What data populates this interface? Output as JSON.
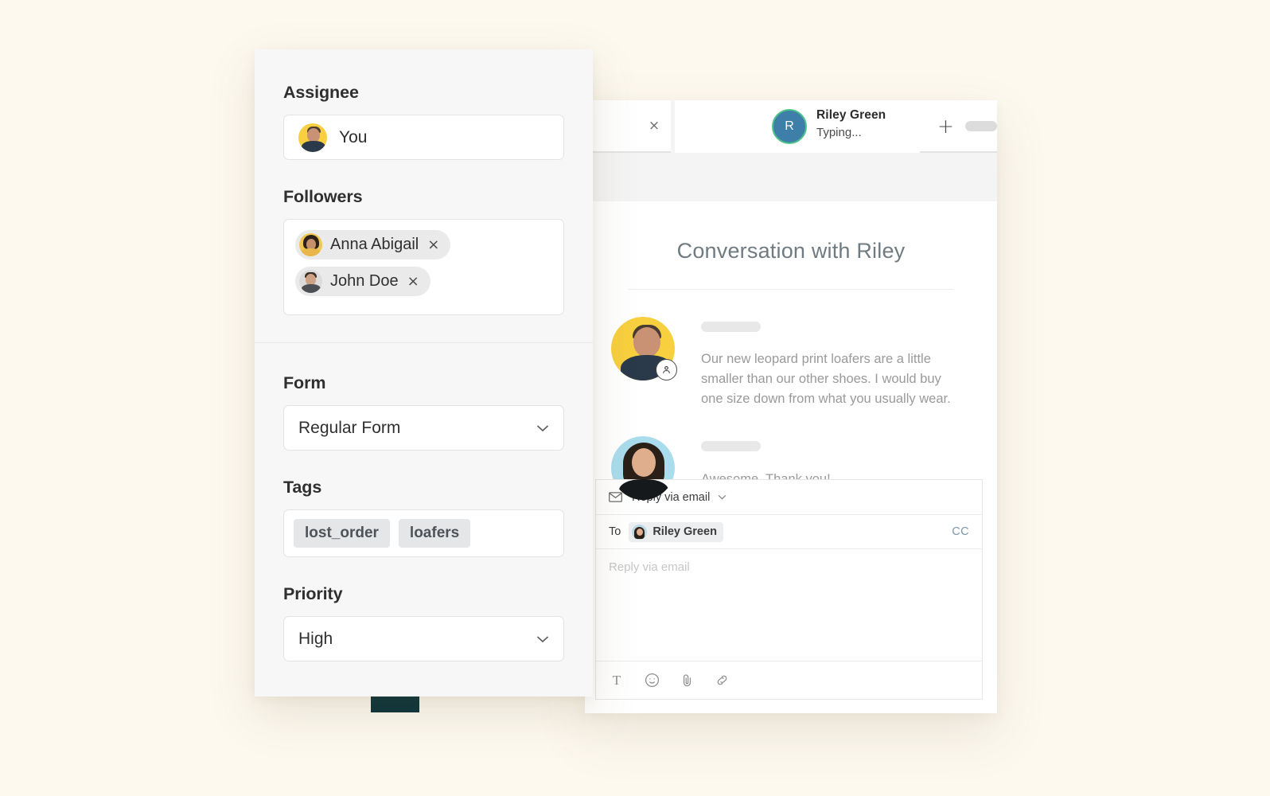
{
  "background_color": "#fdf9ef",
  "tabs": {
    "previous_tab": {
      "close_label": "×"
    },
    "active_tab": {
      "avatar_initial": "R",
      "name": "Riley Green",
      "status": "Typing...",
      "close_label": "×",
      "ring_color": "#4ec48a",
      "avatar_color": "#3d7fa8"
    },
    "new_tab": {
      "plus_label": "+"
    }
  },
  "conversation": {
    "title": "Conversation with Riley",
    "messages": [
      {
        "author_hidden": true,
        "avatar_bg": "#f7cf3f",
        "text": "Our new leopard print loafers are a little smaller than our other shoes. I would buy one size down from what you usually wear."
      },
      {
        "author_hidden": true,
        "avatar_bg": "#a9dced",
        "text": "Awesome. Thank you!"
      }
    ]
  },
  "composer": {
    "channel_label": "Reply via email",
    "to_label": "To",
    "to_recipient": "Riley Green",
    "cc_label": "CC",
    "body_placeholder": "Reply via email",
    "tools": [
      {
        "name": "text-format",
        "glyph": "T"
      },
      {
        "name": "emoji",
        "glyph": ""
      },
      {
        "name": "attachment",
        "glyph": ""
      },
      {
        "name": "link",
        "glyph": ""
      }
    ]
  },
  "side_panel": {
    "assignee": {
      "label": "Assignee",
      "value": "You"
    },
    "followers": {
      "label": "Followers",
      "items": [
        {
          "name": "Anna Abigail",
          "remove_label": "×"
        },
        {
          "name": "John Doe",
          "remove_label": "×"
        }
      ]
    },
    "form": {
      "label": "Form",
      "value": "Regular Form"
    },
    "tags": {
      "label": "Tags",
      "items": [
        "lost_order",
        "loafers"
      ]
    },
    "priority": {
      "label": "Priority",
      "value": "High"
    }
  },
  "accent": {
    "teal_block_color": "#0b343a"
  }
}
